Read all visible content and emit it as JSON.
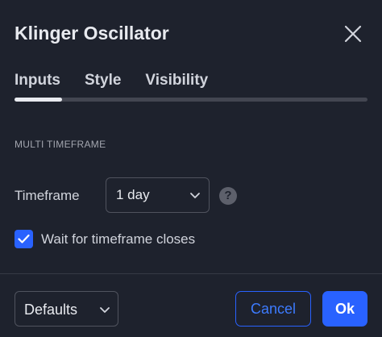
{
  "dialog": {
    "title": "Klinger Oscillator",
    "close_icon": "close-icon"
  },
  "tabs": [
    {
      "label": "Inputs",
      "active": true
    },
    {
      "label": "Style",
      "active": false
    },
    {
      "label": "Visibility",
      "active": false
    }
  ],
  "section": {
    "label": "MULTI TIMEFRAME"
  },
  "timeframe": {
    "label": "Timeframe",
    "value": "1 day",
    "help_glyph": "?"
  },
  "wait_closes": {
    "label": "Wait for timeframe closes",
    "checked": true
  },
  "footer": {
    "defaults_label": "Defaults",
    "cancel_label": "Cancel",
    "ok_label": "Ok"
  },
  "colors": {
    "background": "#1e222d",
    "accent": "#2962ff",
    "text": "#d1d4dc",
    "muted": "#a3a6af",
    "border": "#50535e"
  }
}
